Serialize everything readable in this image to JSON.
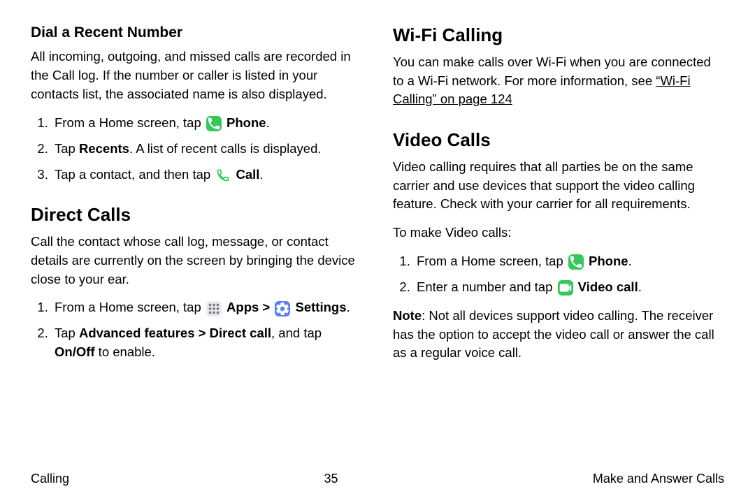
{
  "left": {
    "h3a": "Dial a Recent Number",
    "p1": "All incoming, outgoing, and missed calls are recorded in the Call log. If the number or caller is listed in your contacts list, the associated name is also displayed.",
    "li1_pre": "From a Home screen, tap ",
    "li1_b": "Phone",
    "li1_post": ".",
    "li2_pre": "Tap ",
    "li2_b": "Recents",
    "li2_post": ". A list of recent calls is displayed.",
    "li3_pre": "Tap a contact, and then tap ",
    "li3_b": "Call",
    "li3_post": ".",
    "h2b": "Direct Calls",
    "p2": "Call the contact whose call log, message, or contact details are currently on the screen by bringing the device close to your ear.",
    "li4_pre": "From a Home screen, tap ",
    "li4_b1": "Apps",
    "li4_mid": " > ",
    "li4_b2": "Settings",
    "li4_post": ".",
    "li5_pre": "Tap ",
    "li5_b1": "Advanced features > Direct call",
    "li5_mid": ", and tap ",
    "li5_b2": "On/Off",
    "li5_post": " to enable."
  },
  "right": {
    "h2a": "Wi-Fi Calling",
    "p1_pre": "You can make calls over Wi-Fi when you are connected to a Wi-Fi network. For more information, see ",
    "p1_link": "“Wi-Fi Calling” on page 124",
    "h2b": "Video Calls",
    "p2": "Video calling requires that all parties be on the same carrier and use devices that support the video calling feature. Check with your carrier for all requirements.",
    "p3": "To make Video calls:",
    "li1_pre": "From a Home screen, tap ",
    "li1_b": "Phone",
    "li1_post": ".",
    "li2_pre": "Enter a number and tap ",
    "li2_b": "Video call",
    "li2_post": ".",
    "note_pre": "Note",
    "note_post": ": Not all devices support video calling. The receiver has the option to accept the video call or answer the call as a regular voice call."
  },
  "footer": {
    "left": "Calling",
    "center": "35",
    "right": "Make and Answer Calls"
  }
}
